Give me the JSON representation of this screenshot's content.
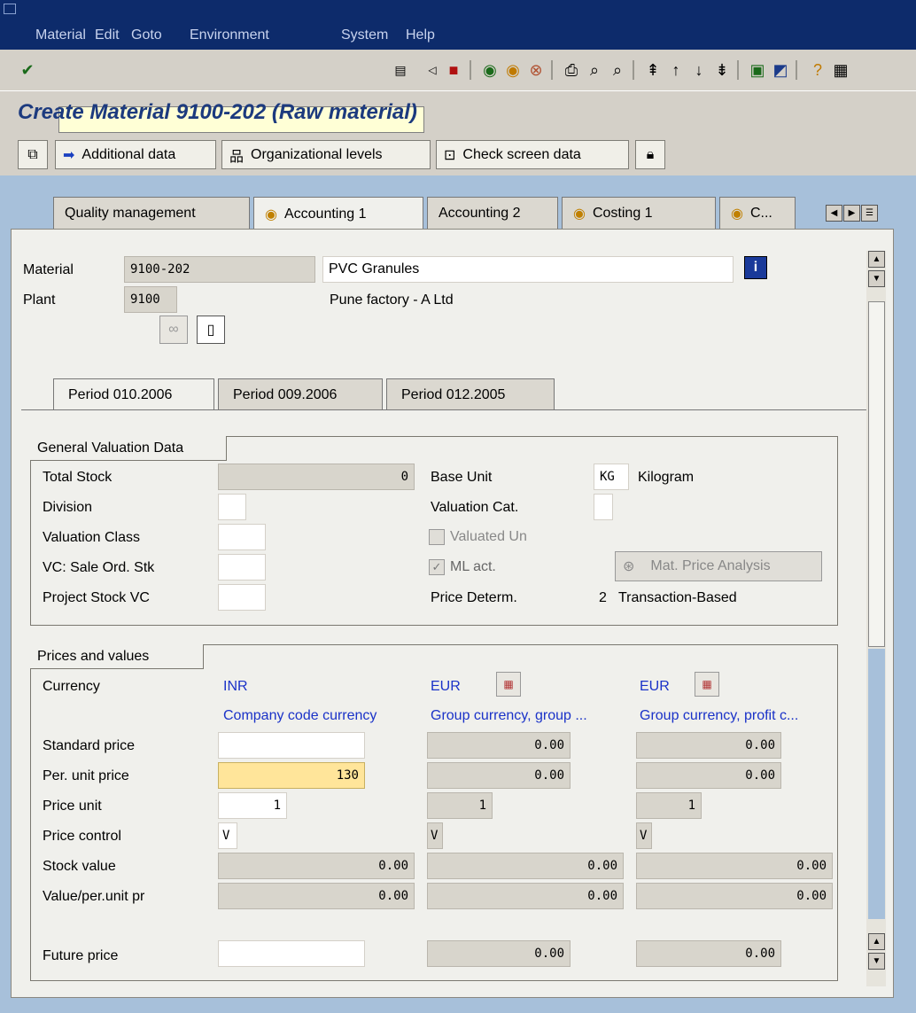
{
  "menu": {
    "items": [
      "Material",
      "Edit",
      "Goto",
      "Environment",
      "System",
      "Help"
    ]
  },
  "title": "Create Material 9100-202 (Raw material)",
  "app_toolbar": {
    "additional_data": "Additional data",
    "org_levels": "Organizational levels",
    "check_screen": "Check screen data"
  },
  "tabs": [
    "Quality management",
    "Accounting 1",
    "Accounting 2",
    "Costing 1",
    "C..."
  ],
  "header": {
    "material_label": "Material",
    "material_value": "9100-202",
    "material_desc": "PVC Granules",
    "plant_label": "Plant",
    "plant_value": "9100",
    "plant_desc": "Pune factory - A Ltd"
  },
  "periods": [
    "Period 010.2006",
    "Period 009.2006",
    "Period 012.2005"
  ],
  "gvd": {
    "title": "General Valuation Data",
    "total_stock_label": "Total Stock",
    "total_stock": "0",
    "division_label": "Division",
    "valuation_class_label": "Valuation Class",
    "vc_sale_label": "VC: Sale Ord. Stk",
    "project_stock_label": "Project Stock VC",
    "base_unit_label": "Base Unit",
    "base_unit": "KG",
    "base_unit_desc": "Kilogram",
    "valuation_cat_label": "Valuation Cat.",
    "valuated_un_label": "Valuated Un",
    "ml_act_label": "ML act.",
    "mat_price_btn": "Mat. Price Analysis",
    "price_determ_label": "Price Determ.",
    "price_determ": "2",
    "price_determ_desc": "Transaction-Based"
  },
  "pv": {
    "title": "Prices and values",
    "currency_label": "Currency",
    "cur1": "INR",
    "cur2": "EUR",
    "cur3": "EUR",
    "cur1_desc": "Company code currency",
    "cur2_desc": "Group currency, group ...",
    "cur3_desc": "Group currency, profit c...",
    "standard_price_label": "Standard price",
    "per_unit_label": "Per. unit price",
    "price_unit_label": "Price unit",
    "price_control_label": "Price control",
    "stock_value_label": "Stock value",
    "value_per_unit_label": "Value/per.unit pr",
    "future_price_label": "Future price",
    "std2": "0.00",
    "std3": "0.00",
    "pup1": "130",
    "pup2": "0.00",
    "pup3": "0.00",
    "pu1": "1",
    "pu2": "1",
    "pu3": "1",
    "pc1": "V",
    "pc2": "V",
    "pc3": "V",
    "sv1": "0.00",
    "sv2": "0.00",
    "sv3": "0.00",
    "vpu1": "0.00",
    "vpu2": "0.00",
    "vpu3": "0.00",
    "fp2": "0.00",
    "fp3": "0.00"
  }
}
